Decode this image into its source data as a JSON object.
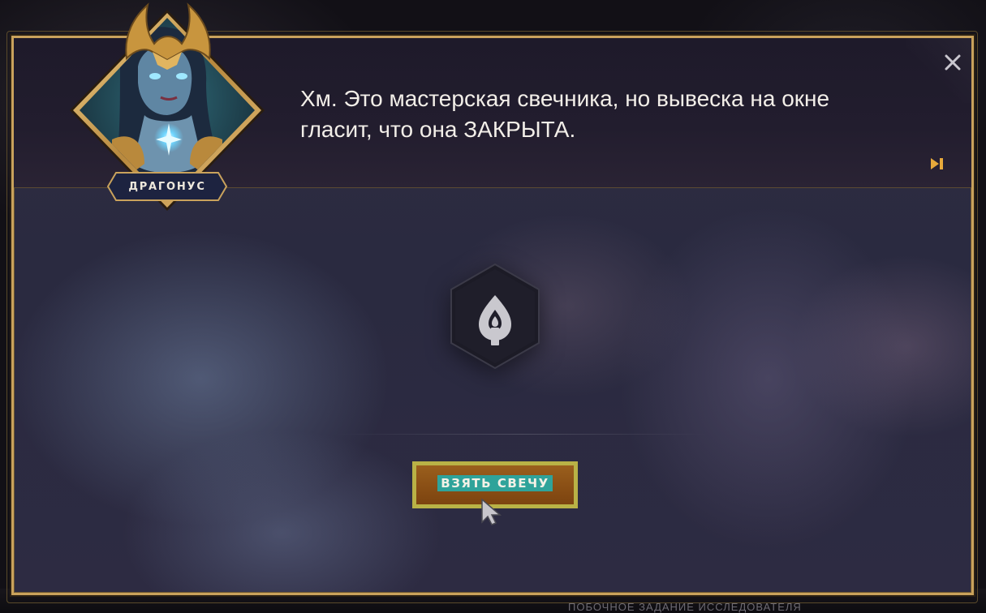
{
  "dialog": {
    "speaker_name": "ДРАГОНУС",
    "text": "Хм. Это мастерская свечника, но вывеска на окне гласит, что она ЗАКРЫТА.",
    "close_icon": "close-icon",
    "skip_icon": "skip-forward-icon"
  },
  "item": {
    "icon": "candle-icon"
  },
  "action": {
    "take_label": "ВЗЯТЬ СВЕЧУ"
  },
  "background": {
    "bottom_text": "ПОБОЧНОЕ ЗАДАНИЕ ИССЛЕДОВАТЕЛЯ"
  },
  "colors": {
    "frame_gold": "#c9a25c",
    "button_orange": "#8a4f15",
    "button_highlight": "#b9b246",
    "label_highlight": "#2fa39a"
  }
}
